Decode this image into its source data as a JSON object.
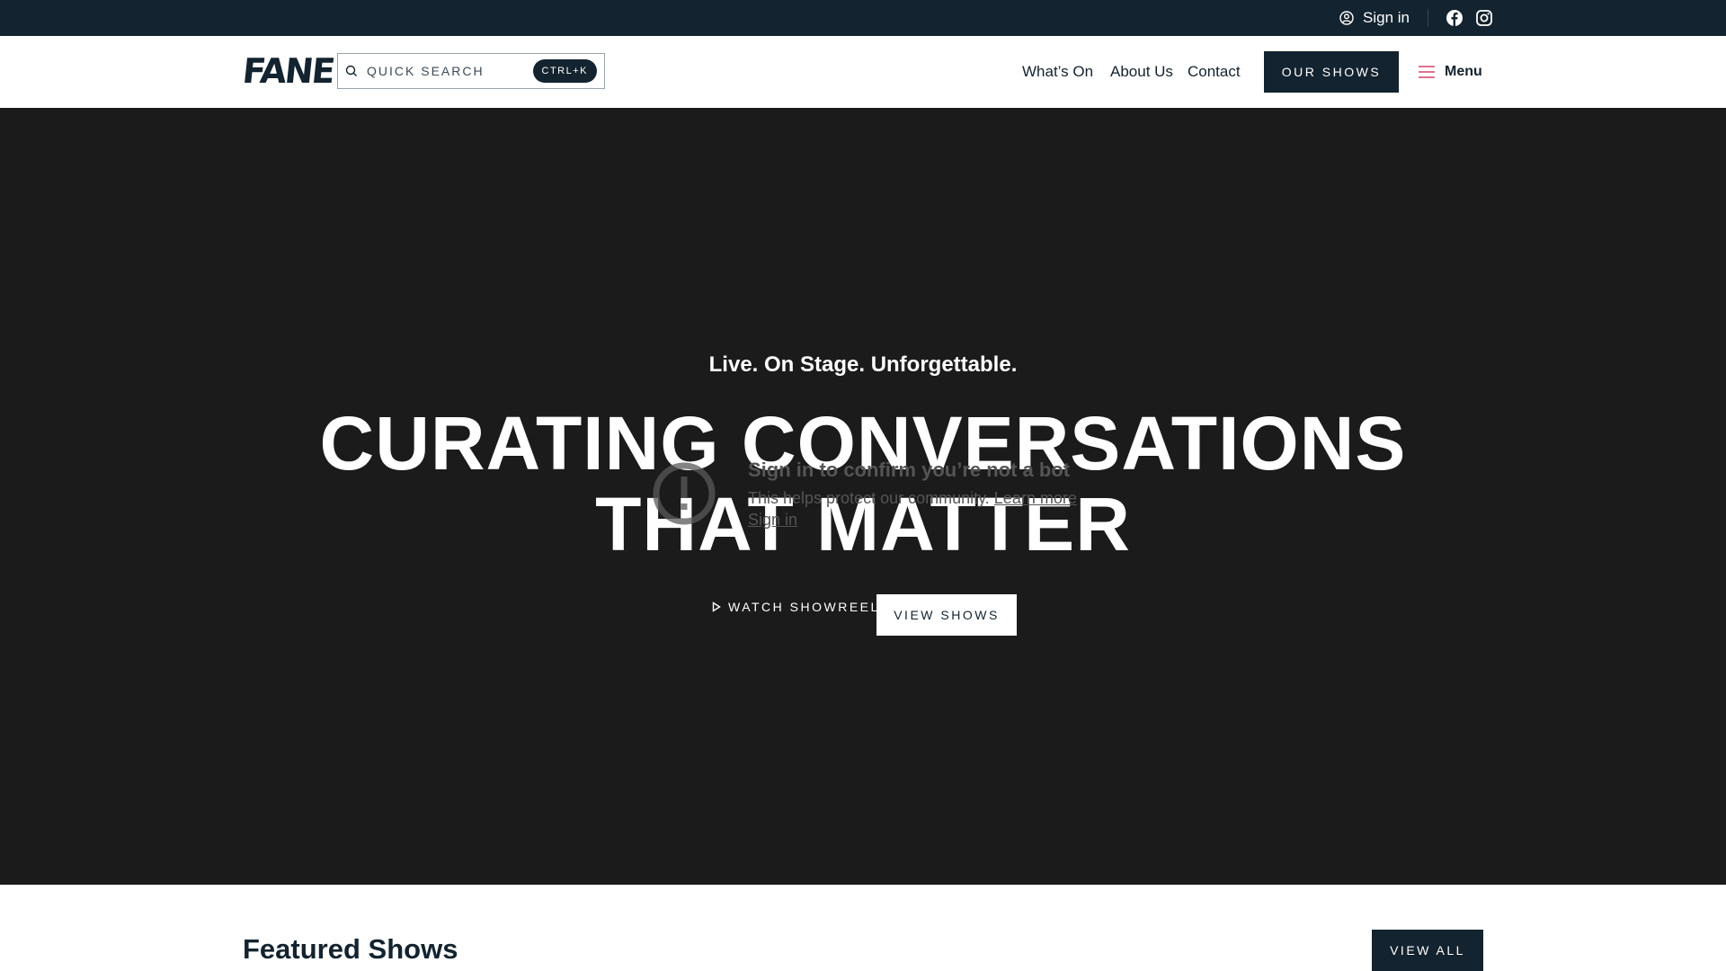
{
  "topbar": {
    "signin_label": "Sign in",
    "icons": [
      "user-circle-icon",
      "facebook-icon",
      "instagram-icon"
    ]
  },
  "header": {
    "logo": "FANE",
    "search": {
      "placeholder": "QUICK SEARCH",
      "shortcut": "CTRL+K"
    },
    "nav": [
      {
        "label": "What’s On"
      },
      {
        "label": "About Us"
      },
      {
        "label": "Contact"
      }
    ],
    "cta_label": "OUR SHOWS",
    "menu_label": "Menu"
  },
  "hero": {
    "tagline": "Live. On Stage. Unforgettable.",
    "headline_line1": "CURATING CONVERSATIONS",
    "headline_line2": "THAT MATTER",
    "watch_label": "WATCH SHOWREEL",
    "view_shows_label": "VIEW SHOWS"
  },
  "overlay": {
    "title": "Sign in to confirm you’re not a bot",
    "subtitle": "This helps protect our community.",
    "learn_more": "Learn more",
    "signin": "Sign in"
  },
  "featured": {
    "title": "Featured Shows",
    "view_all_label": "VIEW ALL"
  },
  "colors": {
    "navy": "#13232f",
    "hero_bg": "#1b1b1b",
    "menu_accent": "#d0456b"
  }
}
